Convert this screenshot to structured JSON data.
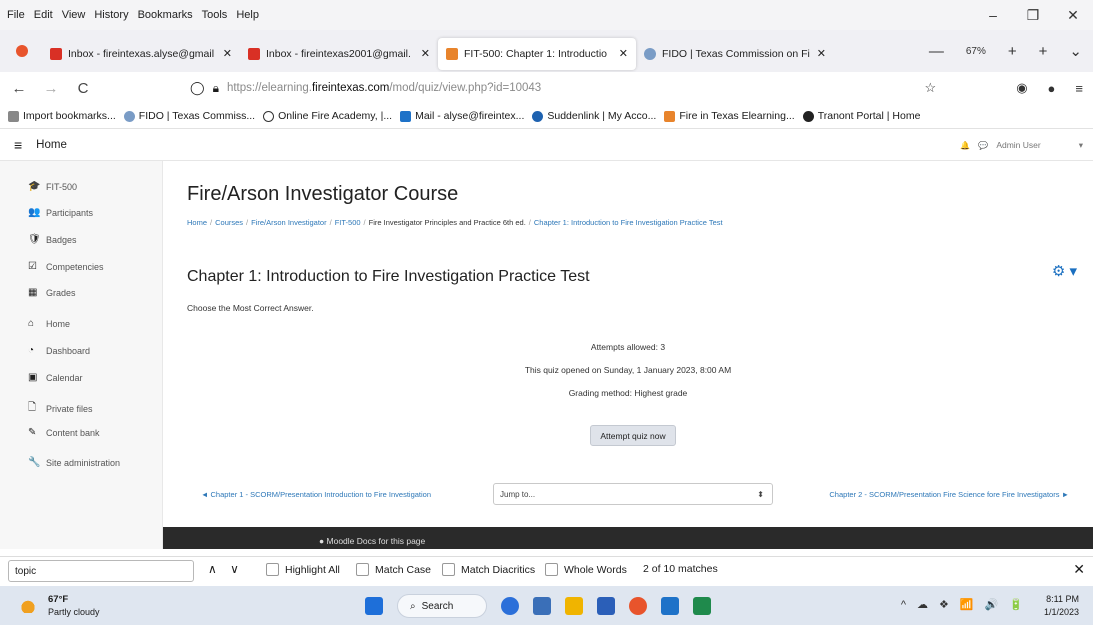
{
  "menu": [
    "File",
    "Edit",
    "View",
    "History",
    "Bookmarks",
    "Tools",
    "Help"
  ],
  "window_controls": {
    "minimize": "–",
    "restore": "❐",
    "close": "✕"
  },
  "tabs": [
    {
      "title": "Inbox - fireintexas.alyse@gmail",
      "close": "✕",
      "favicon_color": "#d93025"
    },
    {
      "title": "Inbox - fireintexas2001@gmail.",
      "close": "✕",
      "favicon_color": "#d93025"
    },
    {
      "title": "FIT-500: Chapter 1: Introductio",
      "close": "✕",
      "favicon_color": "#e8842c",
      "active": true
    },
    {
      "title": "FIDO | Texas Commission on Fi",
      "close": "✕",
      "favicon_color": "#7a9cc6"
    }
  ],
  "tab_tools": {
    "minus": "—",
    "zoom": "67%",
    "plus": "+",
    "new_tab": "+",
    "list_all": "⌄"
  },
  "nav": {
    "back": "←",
    "forward": "→",
    "reload": "C",
    "url_pre": "https://elearning.",
    "url_host": "fireintexas.com",
    "url_post": "/mod/quiz/view.php?id=10043",
    "star": "☆",
    "pocket": "◉",
    "account": "●",
    "menu": "≡"
  },
  "bookmarks": [
    {
      "label": "Import bookmarks...",
      "color": "#555"
    },
    {
      "label": "FIDO | Texas Commiss...",
      "color": "#7a9cc6"
    },
    {
      "label": "Online Fire Academy, |...",
      "color": "#333"
    },
    {
      "label": "Mail - alyse@fireintex...",
      "color": "#1e72c8"
    },
    {
      "label": "Suddenlink | My Acco...",
      "color": "#1e62b0"
    },
    {
      "label": "Fire in Texas Elearning...",
      "color": "#e8842c"
    },
    {
      "label": "Tranont Portal | Home",
      "color": "#222"
    }
  ],
  "moodle_nav": {
    "hamburger": "≡",
    "home": "Home",
    "bell": "🔔",
    "chat": "💬",
    "user": "Admin User",
    "caret": "▾"
  },
  "sidebar": [
    {
      "icon": "🎓",
      "label": "FIT-500"
    },
    {
      "icon": "👥",
      "label": "Participants"
    },
    {
      "icon": "🛡",
      "label": "Badges"
    },
    {
      "icon": "☑",
      "label": "Competencies"
    },
    {
      "icon": "▦",
      "label": "Grades"
    },
    {
      "icon": "⌂",
      "label": "Home"
    },
    {
      "icon": "◔",
      "label": "Dashboard"
    },
    {
      "icon": "▣",
      "label": "Calendar"
    },
    {
      "icon": "🗋",
      "label": "Private files"
    },
    {
      "icon": "✎",
      "label": "Content bank"
    },
    {
      "icon": "🔧",
      "label": "Site administration"
    }
  ],
  "main": {
    "course_title": "Fire/Arson Investigator Course",
    "breadcrumb": [
      "Home",
      "Courses",
      "Fire/Arson Investigator",
      "FIT-500",
      "Fire Investigator Principles and Practice 6th ed.",
      "Chapter 1: Introduction to Fire Investigation Practice Test"
    ],
    "breadcrumb_sep": "/",
    "quiz_title": "Chapter 1: Introduction to Fire Investigation Practice Test",
    "gear": "⚙ ▾",
    "intro": "Choose the Most Correct Answer.",
    "attempts": "Attempts allowed: 3",
    "opened": "This quiz opened on Sunday, 1 January 2023, 8:00 AM",
    "grading": "Grading method: Highest grade",
    "attempt_button": "Attempt quiz now",
    "prev_link": "◄ Chapter 1 - SCORM/Presentation Introduction to Fire Investigation",
    "jump_placeholder": "Jump to...",
    "jump_arrow": "⬍",
    "next_link": "Chapter 2 - SCORM/Presentation Fire Science fore Fire Investigators ►"
  },
  "footer": {
    "docs": "Moodle Docs for this page",
    "icon": "●"
  },
  "findbar": {
    "query": "topic",
    "up": "∧",
    "down": "∨",
    "highlight_all": "Highlight All",
    "match_case": "Match Case",
    "match_diacritics": "Match Diacritics",
    "whole_words": "Whole Words",
    "count": "2 of 10 matches",
    "close": "✕"
  },
  "taskbar": {
    "temp": "67°F",
    "condition": "Partly cloudy",
    "search": "Search",
    "app_colors": [
      "#1e6fd9",
      "#2b6fd9",
      "#3a6fb8",
      "#f0b400",
      "#2b5fb8",
      "#e8542c",
      "#1e72c8",
      "#1f8a4c"
    ],
    "tray": [
      "^",
      "☁",
      "❖",
      "📶",
      "🔊",
      "🔋"
    ],
    "time": "8:11 PM",
    "date": "1/1/2023"
  }
}
